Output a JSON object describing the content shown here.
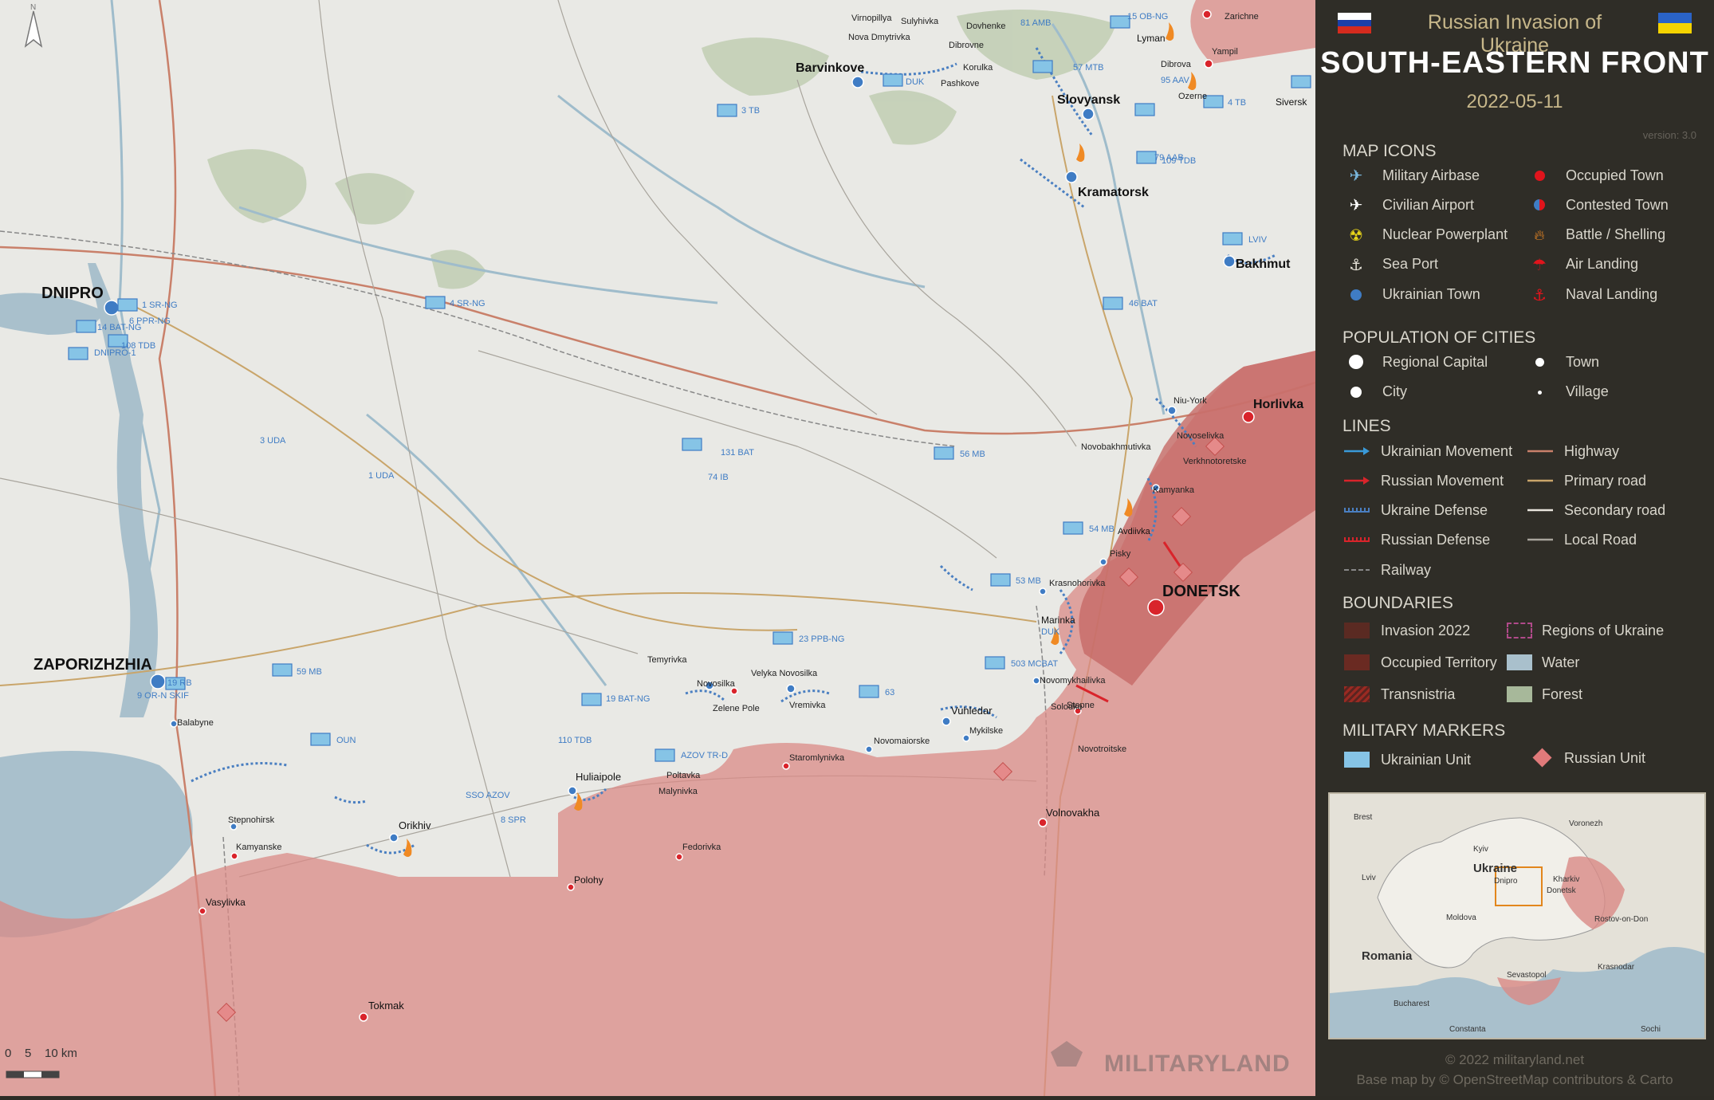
{
  "header": {
    "subtitle": "Russian Invasion of Ukraine",
    "title": "SOUTH-EASTERN FRONT",
    "date": "2022-05-11",
    "version": "version: 3.0"
  },
  "legend": {
    "map_icons_title": "MAP ICONS",
    "map_icons": [
      {
        "label": "Military Airbase",
        "icon": "jet-icon"
      },
      {
        "label": "Occupied Town",
        "icon": "red-dot-icon"
      },
      {
        "label": "Civilian Airport",
        "icon": "plane-icon"
      },
      {
        "label": "Contested Town",
        "icon": "half-dot-icon"
      },
      {
        "label": "Nuclear Powerplant",
        "icon": "radiation-icon"
      },
      {
        "label": "Battle / Shelling",
        "icon": "fire-icon"
      },
      {
        "label": "Sea Port",
        "icon": "anchor-icon"
      },
      {
        "label": "Air Landing",
        "icon": "parachute-icon"
      },
      {
        "label": "Ukrainian Town",
        "icon": "blue-dot-icon"
      },
      {
        "label": "Naval Landing",
        "icon": "red-anchor-icon"
      }
    ],
    "population_title": "POPULATION OF CITIES",
    "population": [
      {
        "label": "Regional Capital"
      },
      {
        "label": "Town"
      },
      {
        "label": "City"
      },
      {
        "label": "Village"
      }
    ],
    "lines_title": "LINES",
    "lines": [
      {
        "label": "Ukrainian Movement",
        "color": "#3a9ad9"
      },
      {
        "label": "Highway",
        "color": "#c9806a"
      },
      {
        "label": "Russian Movement",
        "color": "#d9242b"
      },
      {
        "label": "Primary road",
        "color": "#c9a56a"
      },
      {
        "label": "Ukraine Defense",
        "color": "#4a7fc1"
      },
      {
        "label": "Secondary road",
        "color": "#e8e4dc"
      },
      {
        "label": "Russian Defense",
        "color": "#d9242b"
      },
      {
        "label": "Local Road",
        "color": "#a8a49c"
      },
      {
        "label": "Railway",
        "color": "#777"
      }
    ],
    "boundaries_title": "BOUNDARIES",
    "boundaries": [
      {
        "label": "Invasion 2022",
        "color": "#5a2a22"
      },
      {
        "label": "Regions of Ukraine",
        "color": "#b04a8a"
      },
      {
        "label": "Occupied Territory",
        "color": "#6a2a22"
      },
      {
        "label": "Water",
        "color": "#a9c0cc"
      },
      {
        "label": "Transnistria",
        "color": "#9a2a22"
      },
      {
        "label": "Forest",
        "color": "#a7b89a"
      }
    ],
    "markers_title": "MILITARY MARKERS",
    "markers": [
      {
        "label": "Ukrainian Unit",
        "color": "#86c4e6"
      },
      {
        "label": "Russian Unit",
        "color": "#e07a7a"
      }
    ]
  },
  "inset": {
    "labels": [
      "Brest",
      "Voronezh",
      "Kyiv",
      "Lviv",
      "Ukraine",
      "Kharkiv",
      "Dnipro",
      "Donetsk",
      "Moldova",
      "Rostov-on-Don",
      "Romania",
      "Krasnodar",
      "Sevastopol",
      "Bucharest",
      "Constanta",
      "Sochi"
    ]
  },
  "footer": {
    "copyright": "© 2022 militaryland.net",
    "basemap": "Base map by © OpenStreetMap contributors & Carto"
  },
  "map": {
    "scale": "0    5    10 km",
    "watermark": "MILITARYLAND",
    "major_cities": [
      "DNIPRO",
      "ZAPORIZHZHIA",
      "DONETSK"
    ],
    "towns": [
      "Barvinkove",
      "Slovyansk",
      "Kramatorsk",
      "Bakhmut",
      "Horlivka",
      "Lyman",
      "Siversk",
      "Huliaipole",
      "Orikhiv",
      "Tokmak",
      "Volnovakha",
      "Vuhledar",
      "Marinka",
      "Avdiivka",
      "Polohy",
      "Vasylivka"
    ],
    "villages": [
      "Virnopillya",
      "Sulyhivka",
      "Dovhenke",
      "Nova Dmytrivka",
      "Dibrovne",
      "Korulka",
      "Pashkove",
      "Zarichne",
      "Yampil",
      "Dibrova",
      "Ozerne",
      "Niu-York",
      "Novoselivka",
      "Novobakhmutivka",
      "Verkhnotoretske",
      "Kamyanka",
      "Pisky",
      "Krasnohorivka",
      "Novomykhailivka",
      "Solodke",
      "Stepne",
      "Mykilske",
      "Novotroitske",
      "Novomaiorske",
      "Staromlynivka",
      "Velyka Novosilka",
      "Vremivka",
      "Novosilka",
      "Temyrivka",
      "Zelene Pole",
      "Poltavka",
      "Malynivka",
      "Fedorivka",
      "Stepnohirsk",
      "Kamyanske",
      "Balabyne"
    ],
    "units": [
      "1 SR-NG",
      "14 BAT-NG",
      "6 PPR-NG",
      "108 TDB",
      "DNIPRO-1",
      "4 SR-NG",
      "3 UDA",
      "1 UDA",
      "74 IB",
      "131 BAT",
      "56 MB",
      "54 MB",
      "53 MB",
      "23 PPB-NG",
      "503 MCBAT",
      "63",
      "19 BAT-NG",
      "9 OR-N SKIF",
      "19 RB",
      "59 MB",
      "OUN",
      "110 TDB",
      "AZOV TR-D",
      "SSO AZOV",
      "8 SPR",
      "3 TB",
      "DUK",
      "81 AMB",
      "57 MTB",
      "15 OB-NG",
      "95 AAV",
      "79 AAB",
      "4 TB",
      "109 TDB",
      "LVIV",
      "46 BAT",
      "DUK"
    ]
  }
}
